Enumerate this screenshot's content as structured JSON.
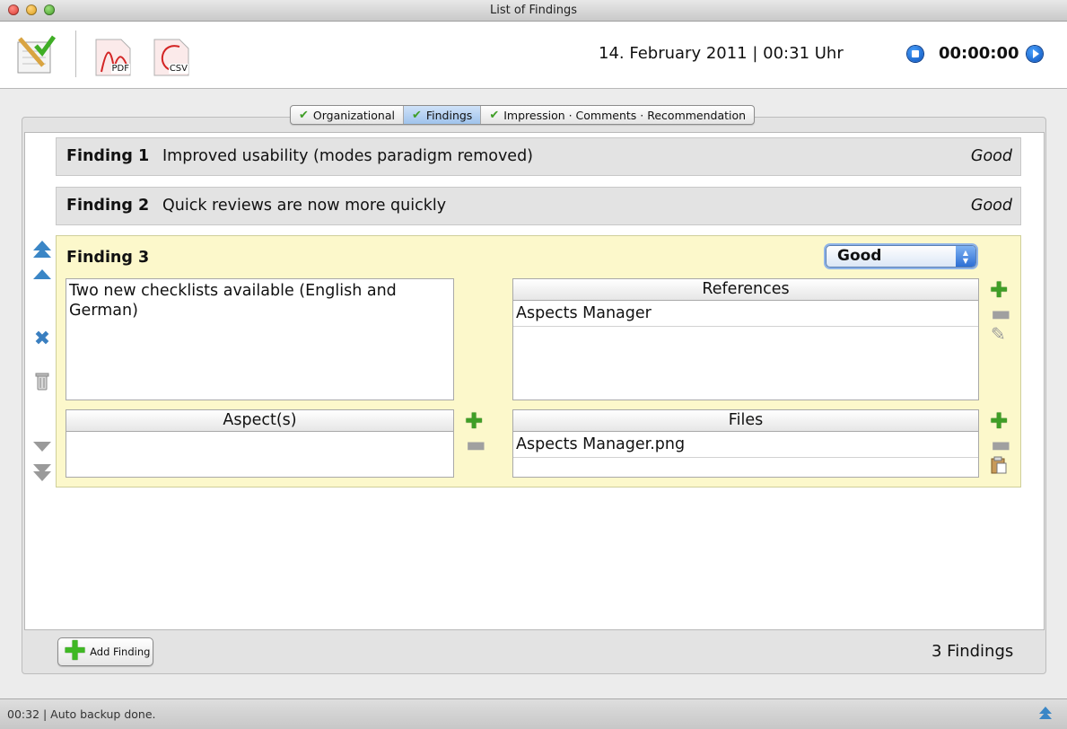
{
  "window": {
    "title": "List of Findings"
  },
  "toolbar": {
    "pdf_label": "PDF",
    "csv_label": "CSV",
    "datetime": "14. February 2011 | 00:31 Uhr",
    "timer": "00:00:00"
  },
  "tabs": [
    {
      "label": "Organizational",
      "active": false
    },
    {
      "label": "Findings",
      "active": true
    },
    {
      "label": "Impression · Comments · Recommendation",
      "active": false
    }
  ],
  "findings": [
    {
      "label": "Finding 1",
      "title": "Improved usability (modes paradigm removed)",
      "rating": "Good"
    },
    {
      "label": "Finding 2",
      "title": "Quick reviews are now more quickly",
      "rating": "Good"
    }
  ],
  "current_finding": {
    "label": "Finding 3",
    "rating": "Good",
    "description": "Two new checklists available (English and German)",
    "references_header": "References",
    "references": [
      "Aspects Manager"
    ],
    "aspects_header": "Aspect(s)",
    "aspects": [],
    "files_header": "Files",
    "files": [
      "Aspects Manager.png"
    ]
  },
  "footer": {
    "add_button": "Add Finding",
    "count": "3 Findings"
  },
  "status": {
    "text": "00:32 | Auto backup done."
  },
  "colors": {
    "accent": "#3a86c6",
    "plus_green": "#3f9e26",
    "selected_tab": "#9fc3ec",
    "expanded_bg": "#fcf8cb"
  }
}
